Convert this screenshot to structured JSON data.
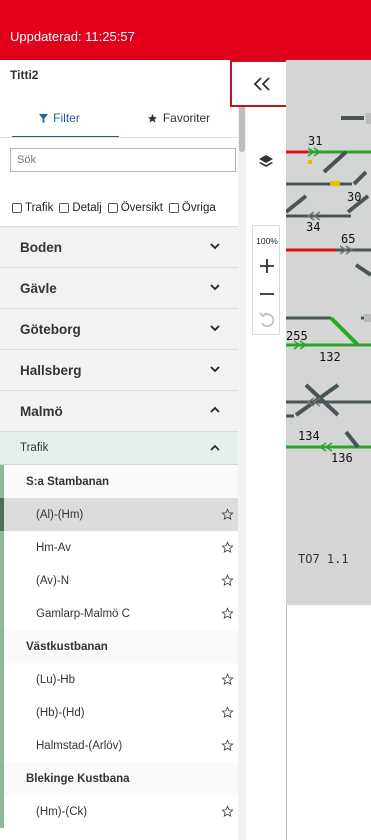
{
  "header": {
    "title": "Uppdaterad: 11:25:57",
    "color": "#e0001a"
  },
  "panel": {
    "user": "Titti2",
    "tabs": [
      {
        "label": "Filter",
        "icon": "filter-icon",
        "active": true
      },
      {
        "label": "Favoriter",
        "icon": "star-icon",
        "active": false
      }
    ],
    "search": {
      "placeholder": "Sök",
      "value": ""
    },
    "checkboxes": [
      {
        "label": "Trafik",
        "checked": false
      },
      {
        "label": "Detalj",
        "checked": false
      },
      {
        "label": "Översikt",
        "checked": false
      },
      {
        "label": "Övriga",
        "checked": false
      }
    ],
    "groups": [
      {
        "label": "Boden",
        "expanded": false
      },
      {
        "label": "Gävle",
        "expanded": false
      },
      {
        "label": "Göteborg",
        "expanded": false
      },
      {
        "label": "Hallsberg",
        "expanded": false
      },
      {
        "label": "Malmö",
        "expanded": true
      }
    ],
    "subgroup": {
      "label": "Trafik",
      "expanded": true
    },
    "sections": [
      {
        "label": "S:a Stambanan",
        "items": [
          {
            "label": "(Al)-(Hm)",
            "selected": true,
            "favorite": true
          },
          {
            "label": "Hm-Av",
            "favorite": true
          },
          {
            "label": "(Av)-N",
            "favorite": true
          },
          {
            "label": "Gamlarp-Malmö C",
            "favorite": true
          }
        ]
      },
      {
        "label": "Västkustbanan",
        "items": [
          {
            "label": "(Lu)-Hb",
            "favorite": true
          },
          {
            "label": "(Hb)-(Hd)",
            "favorite": true
          },
          {
            "label": "Halmstad-(Arlöv)",
            "favorite": true
          }
        ]
      },
      {
        "label": "Blekinge Kustbana",
        "items": [
          {
            "label": "(Hm)-(Ck)",
            "favorite": true
          }
        ]
      }
    ]
  },
  "toolbar": {
    "collapse_icon": "double-chevron-left-icon",
    "layers_icon": "layers-icon",
    "zoom_level": "100%",
    "zoom_in_icon": "plus-icon",
    "zoom_out_icon": "minus-icon",
    "reset_icon": "undo-icon"
  },
  "map": {
    "labels": [
      "31",
      "30",
      "34",
      "65",
      "255",
      "132",
      "134",
      "136"
    ],
    "footer": "TO7 1.1",
    "colors": {
      "track_green": "#2aa52a",
      "track_red": "#dd1111",
      "track_gray": "#4a5558",
      "signal_yellow": "#e2c000"
    }
  }
}
